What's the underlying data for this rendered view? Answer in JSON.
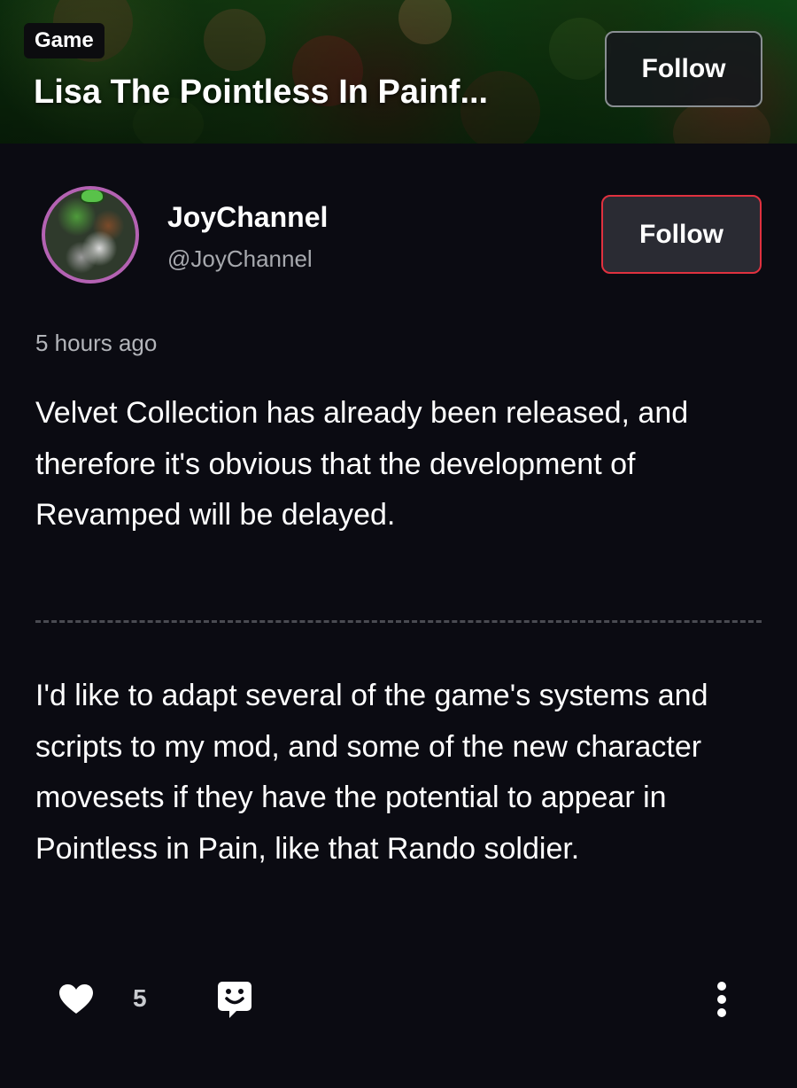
{
  "header": {
    "tag": "Game",
    "title": "Lisa The Pointless In Painf...",
    "follow_label": "Follow"
  },
  "author": {
    "name": "JoyChannel",
    "handle": "@JoyChannel",
    "follow_label": "Follow",
    "avatar_icon": "avatar-image"
  },
  "post": {
    "timestamp": "5 hours ago",
    "paragraphs": [
      "Velvet Collection has already been released, and therefore it's obvious that the development of Revamped will be delayed.",
      "I'd like to adapt several of the game's systems and scripts to my mod, and some of the new character movesets if they have the potential to appear in Pointless in Pain, like that Rando soldier."
    ]
  },
  "actions": {
    "like_count": "5",
    "icons": [
      "heart-icon",
      "react-icon",
      "more-vertical-icon"
    ]
  },
  "colors": {
    "background": "#0b0b12",
    "accent_border": "#e0313f",
    "avatar_ring": "#b462b3",
    "muted_text": "#a7a9ae"
  }
}
